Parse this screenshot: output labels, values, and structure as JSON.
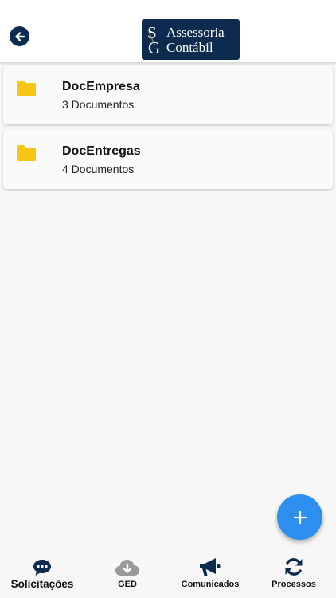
{
  "header": {
    "back_icon": "arrow-left-circle-icon",
    "logo": {
      "mark_s": "S",
      "mark_g": "G",
      "line1": "Assessoria",
      "line2": "Contábil",
      "bg_color": "#0d2b4f"
    }
  },
  "folders": [
    {
      "title": "DocEmpresa",
      "subtitle": "3 Documentos",
      "icon": "folder-icon"
    },
    {
      "title": "DocEntregas",
      "subtitle": "4 Documentos",
      "icon": "folder-icon"
    }
  ],
  "fab": {
    "label": "+",
    "icon": "plus-icon",
    "color": "#2d8ff0"
  },
  "bottom_nav": {
    "items": [
      {
        "label": "Solicitações",
        "icon": "chat-bubble-icon",
        "active": true
      },
      {
        "label": "GED",
        "icon": "cloud-download-icon",
        "active": false
      },
      {
        "label": "Comunicados",
        "icon": "megaphone-icon",
        "active": false
      },
      {
        "label": "Processos",
        "icon": "sync-icon",
        "active": false
      }
    ]
  },
  "colors": {
    "primary_dark": "#0d2b4f",
    "folder": "#f5c518",
    "fab": "#2d8ff0",
    "muted_icon": "#9a9a9a"
  }
}
